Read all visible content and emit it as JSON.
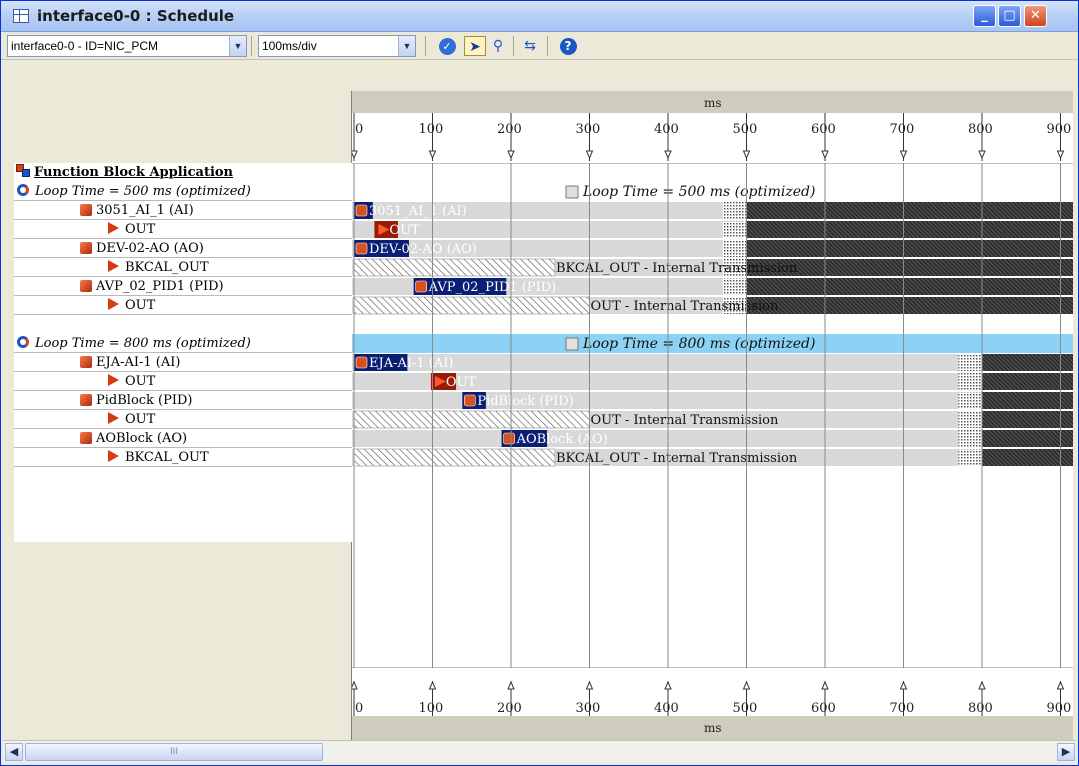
{
  "window": {
    "title": "interface0-0 : Schedule"
  },
  "toolbar": {
    "interface_combo": "interface0-0 - ID=NIC_PCM",
    "scale_combo": "100ms/div"
  },
  "timeline": {
    "unit": "ms",
    "ticks": [
      "0",
      "100",
      "200",
      "300",
      "400",
      "500",
      "600",
      "700",
      "800",
      "900"
    ],
    "max_ms": 900,
    "colors": {
      "block": "#0a1f73",
      "selection": "#8cd2f4",
      "busy": "#454545"
    }
  },
  "tree": {
    "root": "Function Block Application",
    "rows": [
      {
        "indent": 1,
        "type": "loop",
        "label": "Loop Time = 500 ms (optimized)",
        "bar": {
          "kind": "loop",
          "label": "Loop Time = 500 ms (optimized)"
        }
      },
      {
        "indent": 2,
        "type": "block",
        "label": "3051_AI_1 (AI)",
        "bar": {
          "kind": "block",
          "start": 0,
          "dur": 24,
          "label": "3051_AI_1 (AI)",
          "cycle": [
            470,
            500
          ]
        }
      },
      {
        "indent": 3,
        "type": "output",
        "label": "OUT",
        "bar": {
          "kind": "out",
          "start": 26,
          "dur": 30,
          "label": "OUT",
          "cycle": [
            470,
            500
          ]
        }
      },
      {
        "indent": 2,
        "type": "block",
        "label": "DEV-02-AO (AO)",
        "bar": {
          "kind": "block",
          "start": 0,
          "dur": 70,
          "label": "DEV-02-AO (AO)",
          "cycle": [
            470,
            500
          ]
        }
      },
      {
        "indent": 3,
        "type": "output",
        "label": "BKCAL_OUT",
        "bar": {
          "kind": "trans",
          "start": 0,
          "dur": 256,
          "label": "BKCAL_OUT - Internal Transmission",
          "cycle": [
            470,
            500
          ]
        }
      },
      {
        "indent": 2,
        "type": "block",
        "label": "AVP_02_PID1 (PID)",
        "bar": {
          "kind": "block",
          "start": 76,
          "dur": 118,
          "label": "AVP_02_PID1 (PID)",
          "cycle": [
            470,
            500
          ]
        }
      },
      {
        "indent": 3,
        "type": "output",
        "label": "OUT",
        "bar": {
          "kind": "trans",
          "start": 0,
          "dur": 300,
          "label": "OUT - Internal Transmission",
          "cycle": [
            470,
            500
          ]
        }
      },
      {
        "indent": 0,
        "type": "blank",
        "label": ""
      },
      {
        "indent": 1,
        "type": "loop",
        "label": "Loop Time = 800 ms (optimized)",
        "bar": {
          "kind": "loop",
          "label": "Loop Time = 800 ms (optimized)",
          "selected": true
        }
      },
      {
        "indent": 2,
        "type": "block",
        "label": "EJA-AI-1 (AI)",
        "bar": {
          "kind": "block",
          "start": 0,
          "dur": 68,
          "label": "EJA-AI-1 (AI)",
          "cycle": [
            770,
            800
          ]
        }
      },
      {
        "indent": 3,
        "type": "output",
        "label": "OUT",
        "bar": {
          "kind": "out",
          "start": 98,
          "dur": 32,
          "label": "OUT",
          "cycle": [
            770,
            800
          ]
        }
      },
      {
        "indent": 2,
        "type": "block",
        "label": "PidBlock (PID)",
        "bar": {
          "kind": "block",
          "start": 138,
          "dur": 30,
          "label": "PidBlock (PID)",
          "cycle": [
            770,
            800
          ]
        }
      },
      {
        "indent": 3,
        "type": "output",
        "label": "OUT",
        "bar": {
          "kind": "trans",
          "start": 0,
          "dur": 300,
          "label": "OUT - Internal Transmission",
          "cycle": [
            770,
            800
          ]
        }
      },
      {
        "indent": 2,
        "type": "block",
        "label": "AOBlock (AO)",
        "bar": {
          "kind": "block",
          "start": 188,
          "dur": 58,
          "label": "AOBlock (AO)",
          "cycle": [
            770,
            800
          ]
        }
      },
      {
        "indent": 3,
        "type": "output",
        "label": "BKCAL_OUT",
        "bar": {
          "kind": "trans",
          "start": 0,
          "dur": 256,
          "label": "BKCAL_OUT - Internal Transmission",
          "cycle": [
            770,
            800
          ]
        }
      }
    ]
  },
  "scrollbar": {
    "thumb_grip": "III"
  }
}
